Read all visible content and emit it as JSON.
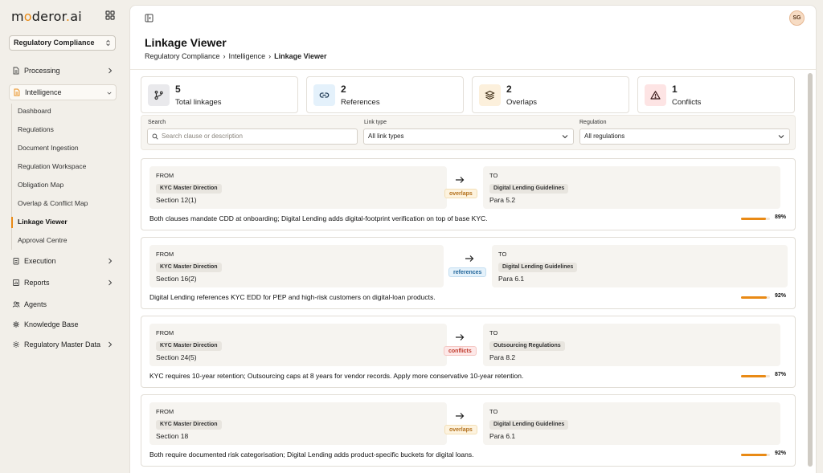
{
  "brand": {
    "logo_prefix": "m",
    "logo_o": "o",
    "logo_rest": "deror",
    "logo_dot": ".",
    "logo_suffix": "ai",
    "accent": "#e98a15"
  },
  "org_select": {
    "value": "Regulatory Compliance"
  },
  "sidebar": {
    "items": [
      {
        "label": "Processing",
        "icon": "document-icon",
        "has_arrow": true
      },
      {
        "label": "Intelligence",
        "icon": "document-icon",
        "expanded": true
      },
      {
        "label": "Execution",
        "icon": "clipboard-icon",
        "has_arrow": true
      },
      {
        "label": "Reports",
        "icon": "chart-icon",
        "has_arrow": true
      },
      {
        "label": "Agents",
        "icon": "users-icon"
      },
      {
        "label": "Knowledge Base",
        "icon": "network-icon"
      },
      {
        "label": "Regulatory Master Data",
        "icon": "gear-icon",
        "has_arrow": true
      }
    ],
    "sub_items": [
      {
        "label": "Dashboard"
      },
      {
        "label": "Regulations"
      },
      {
        "label": "Document Ingestion"
      },
      {
        "label": "Regulation Workspace"
      },
      {
        "label": "Obligation Map"
      },
      {
        "label": "Overlap & Conflict Map"
      },
      {
        "label": "Linkage Viewer",
        "active": true
      },
      {
        "label": "Approval Centre"
      }
    ]
  },
  "topbar": {
    "avatar_initials": "SG"
  },
  "page": {
    "title": "Linkage Viewer",
    "breadcrumb": [
      "Regulatory Compliance",
      "Intelligence",
      "Linkage Viewer"
    ],
    "breadcrumb_sep": "›"
  },
  "stats": [
    {
      "value": "5",
      "label": "Total linkages",
      "icon": "branch-icon",
      "color": "#e9e9ec"
    },
    {
      "value": "2",
      "label": "References",
      "icon": "link-icon",
      "color": "#e4f1fb"
    },
    {
      "value": "2",
      "label": "Overlaps",
      "icon": "layers-icon",
      "color": "#fcf0dc"
    },
    {
      "value": "1",
      "label": "Conflicts",
      "icon": "warning-icon",
      "color": "#fde4e4"
    }
  ],
  "filters": {
    "search_label": "Search",
    "search_placeholder": "Search clause or description",
    "link_type_label": "Link type",
    "link_type_value": "All link types",
    "regulation_label": "Regulation",
    "regulation_value": "All regulations"
  },
  "links": [
    {
      "from_caption": "FROM",
      "from_reg": "KYC Master Direction",
      "from_ref": "Section 12(1)",
      "to_caption": "TO",
      "to_reg": "Digital Lending Guidelines",
      "to_ref": "Para 5.2",
      "relation": "overlaps",
      "description": "Both clauses mandate CDD at onboarding; Digital Lending adds digital-footprint verification on top of base KYC.",
      "confidence": 89,
      "confidence_label": "89%"
    },
    {
      "from_caption": "FROM",
      "from_reg": "KYC Master Direction",
      "from_ref": "Section 16(2)",
      "to_caption": "TO",
      "to_reg": "Digital Lending Guidelines",
      "to_ref": "Para 6.1",
      "relation": "references",
      "description": "Digital Lending references KYC EDD for PEP and high-risk customers on digital-loan products.",
      "confidence": 92,
      "confidence_label": "92%"
    },
    {
      "from_caption": "FROM",
      "from_reg": "KYC Master Direction",
      "from_ref": "Section 24(5)",
      "to_caption": "TO",
      "to_reg": "Outsourcing Regulations",
      "to_ref": "Para 8.2",
      "relation": "conflicts",
      "description": "KYC requires 10-year retention; Outsourcing caps at 8 years for vendor records. Apply more conservative 10-year retention.",
      "confidence": 87,
      "confidence_label": "87%"
    },
    {
      "from_caption": "FROM",
      "from_reg": "KYC Master Direction",
      "from_ref": "Section 18",
      "to_caption": "TO",
      "to_reg": "Digital Lending Guidelines",
      "to_ref": "Para 6.1",
      "relation": "overlaps",
      "description": "Both require documented risk categorisation; Digital Lending adds product-specific buckets for digital loans.",
      "confidence": 92,
      "confidence_label": "92%"
    }
  ]
}
